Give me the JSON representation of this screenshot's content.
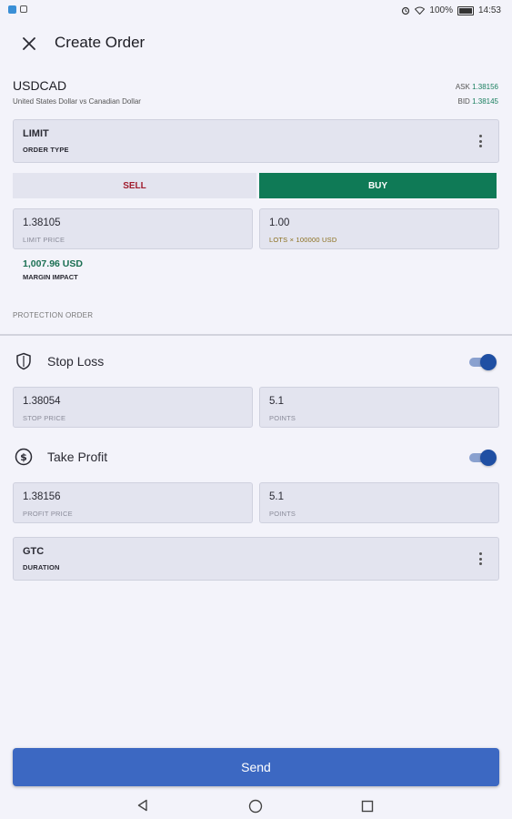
{
  "status_bar": {
    "battery": "100%",
    "time": "14:53"
  },
  "header": {
    "title": "Create Order"
  },
  "instrument": {
    "symbol": "USDCAD",
    "description": "United States Dollar vs Canadian Dollar",
    "ask_label": "ASK",
    "ask_value": "1.38156",
    "bid_label": "BID",
    "bid_value": "1.38145"
  },
  "order_type": {
    "value": "LIMIT",
    "label": "ORDER TYPE"
  },
  "side": {
    "sell_label": "SELL",
    "buy_label": "BUY",
    "selected": "BUY"
  },
  "limit_price": {
    "value": "1.38105",
    "label": "LIMIT PRICE"
  },
  "lots": {
    "value": "1.00",
    "label": "LOTS × 100000 USD"
  },
  "margin": {
    "value": "1,007.96 USD",
    "label": "MARGIN IMPACT"
  },
  "protection": {
    "section_title": "PROTECTION ORDER",
    "stop_loss": {
      "label": "Stop Loss",
      "enabled": true,
      "price_value": "1.38054",
      "price_label": "STOP PRICE",
      "points_value": "5.1",
      "points_label": "POINTS"
    },
    "take_profit": {
      "label": "Take Profit",
      "enabled": true,
      "price_value": "1.38156",
      "price_label": "PROFIT PRICE",
      "points_value": "5.1",
      "points_label": "POINTS"
    }
  },
  "duration": {
    "value": "GTC",
    "label": "DURATION"
  },
  "send_label": "Send",
  "colors": {
    "buy": "#0f7a56",
    "sell_text": "#a01c2e",
    "send": "#3c68c2",
    "toggle_on": "#1f4fa3",
    "background": "#f3f3fa"
  },
  "icons": {
    "close": "close-icon",
    "shield": "shield-icon",
    "take_profit": "dollar-circle-icon",
    "more": "more-vert-icon"
  }
}
